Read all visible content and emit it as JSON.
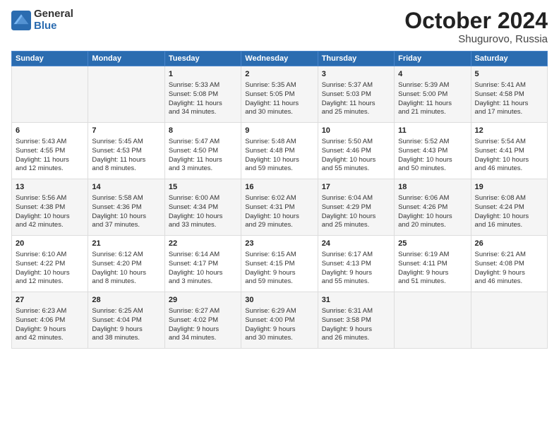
{
  "logo": {
    "general": "General",
    "blue": "Blue"
  },
  "header": {
    "month": "October 2024",
    "location": "Shugurovo, Russia"
  },
  "days_of_week": [
    "Sunday",
    "Monday",
    "Tuesday",
    "Wednesday",
    "Thursday",
    "Friday",
    "Saturday"
  ],
  "weeks": [
    [
      {
        "day": "",
        "info": ""
      },
      {
        "day": "",
        "info": ""
      },
      {
        "day": "1",
        "info": "Sunrise: 5:33 AM\nSunset: 5:08 PM\nDaylight: 11 hours\nand 34 minutes."
      },
      {
        "day": "2",
        "info": "Sunrise: 5:35 AM\nSunset: 5:05 PM\nDaylight: 11 hours\nand 30 minutes."
      },
      {
        "day": "3",
        "info": "Sunrise: 5:37 AM\nSunset: 5:03 PM\nDaylight: 11 hours\nand 25 minutes."
      },
      {
        "day": "4",
        "info": "Sunrise: 5:39 AM\nSunset: 5:00 PM\nDaylight: 11 hours\nand 21 minutes."
      },
      {
        "day": "5",
        "info": "Sunrise: 5:41 AM\nSunset: 4:58 PM\nDaylight: 11 hours\nand 17 minutes."
      }
    ],
    [
      {
        "day": "6",
        "info": "Sunrise: 5:43 AM\nSunset: 4:55 PM\nDaylight: 11 hours\nand 12 minutes."
      },
      {
        "day": "7",
        "info": "Sunrise: 5:45 AM\nSunset: 4:53 PM\nDaylight: 11 hours\nand 8 minutes."
      },
      {
        "day": "8",
        "info": "Sunrise: 5:47 AM\nSunset: 4:50 PM\nDaylight: 11 hours\nand 3 minutes."
      },
      {
        "day": "9",
        "info": "Sunrise: 5:48 AM\nSunset: 4:48 PM\nDaylight: 10 hours\nand 59 minutes."
      },
      {
        "day": "10",
        "info": "Sunrise: 5:50 AM\nSunset: 4:46 PM\nDaylight: 10 hours\nand 55 minutes."
      },
      {
        "day": "11",
        "info": "Sunrise: 5:52 AM\nSunset: 4:43 PM\nDaylight: 10 hours\nand 50 minutes."
      },
      {
        "day": "12",
        "info": "Sunrise: 5:54 AM\nSunset: 4:41 PM\nDaylight: 10 hours\nand 46 minutes."
      }
    ],
    [
      {
        "day": "13",
        "info": "Sunrise: 5:56 AM\nSunset: 4:38 PM\nDaylight: 10 hours\nand 42 minutes."
      },
      {
        "day": "14",
        "info": "Sunrise: 5:58 AM\nSunset: 4:36 PM\nDaylight: 10 hours\nand 37 minutes."
      },
      {
        "day": "15",
        "info": "Sunrise: 6:00 AM\nSunset: 4:34 PM\nDaylight: 10 hours\nand 33 minutes."
      },
      {
        "day": "16",
        "info": "Sunrise: 6:02 AM\nSunset: 4:31 PM\nDaylight: 10 hours\nand 29 minutes."
      },
      {
        "day": "17",
        "info": "Sunrise: 6:04 AM\nSunset: 4:29 PM\nDaylight: 10 hours\nand 25 minutes."
      },
      {
        "day": "18",
        "info": "Sunrise: 6:06 AM\nSunset: 4:26 PM\nDaylight: 10 hours\nand 20 minutes."
      },
      {
        "day": "19",
        "info": "Sunrise: 6:08 AM\nSunset: 4:24 PM\nDaylight: 10 hours\nand 16 minutes."
      }
    ],
    [
      {
        "day": "20",
        "info": "Sunrise: 6:10 AM\nSunset: 4:22 PM\nDaylight: 10 hours\nand 12 minutes."
      },
      {
        "day": "21",
        "info": "Sunrise: 6:12 AM\nSunset: 4:20 PM\nDaylight: 10 hours\nand 8 minutes."
      },
      {
        "day": "22",
        "info": "Sunrise: 6:14 AM\nSunset: 4:17 PM\nDaylight: 10 hours\nand 3 minutes."
      },
      {
        "day": "23",
        "info": "Sunrise: 6:15 AM\nSunset: 4:15 PM\nDaylight: 9 hours\nand 59 minutes."
      },
      {
        "day": "24",
        "info": "Sunrise: 6:17 AM\nSunset: 4:13 PM\nDaylight: 9 hours\nand 55 minutes."
      },
      {
        "day": "25",
        "info": "Sunrise: 6:19 AM\nSunset: 4:11 PM\nDaylight: 9 hours\nand 51 minutes."
      },
      {
        "day": "26",
        "info": "Sunrise: 6:21 AM\nSunset: 4:08 PM\nDaylight: 9 hours\nand 46 minutes."
      }
    ],
    [
      {
        "day": "27",
        "info": "Sunrise: 6:23 AM\nSunset: 4:06 PM\nDaylight: 9 hours\nand 42 minutes."
      },
      {
        "day": "28",
        "info": "Sunrise: 6:25 AM\nSunset: 4:04 PM\nDaylight: 9 hours\nand 38 minutes."
      },
      {
        "day": "29",
        "info": "Sunrise: 6:27 AM\nSunset: 4:02 PM\nDaylight: 9 hours\nand 34 minutes."
      },
      {
        "day": "30",
        "info": "Sunrise: 6:29 AM\nSunset: 4:00 PM\nDaylight: 9 hours\nand 30 minutes."
      },
      {
        "day": "31",
        "info": "Sunrise: 6:31 AM\nSunset: 3:58 PM\nDaylight: 9 hours\nand 26 minutes."
      },
      {
        "day": "",
        "info": ""
      },
      {
        "day": "",
        "info": ""
      }
    ]
  ]
}
